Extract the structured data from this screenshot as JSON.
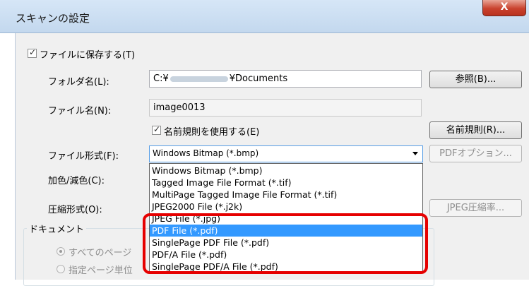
{
  "window": {
    "title": "スキャンの設定",
    "close_label": "X"
  },
  "save_to_file": {
    "label": "ファイルに保存する(T)",
    "checked": true
  },
  "folder": {
    "label": "フォルダ名(L):",
    "value_prefix": "C:¥",
    "value_suffix": "¥Documents",
    "browse_button": "参照(B)..."
  },
  "filename": {
    "label": "ファイル名(N):",
    "value": "image0013"
  },
  "naming_rule": {
    "checkbox_label": "名前規則を使用する(E)",
    "checked": true,
    "button": "名前規則(R)..."
  },
  "file_format": {
    "label": "ファイル形式(F):",
    "selected": "Windows Bitmap (*.bmp)",
    "pdf_options_button": "PDFオプション...",
    "options": [
      "Windows Bitmap (*.bmp)",
      "Tagged Image File Format (*.tif)",
      "MultiPage Tagged Image File Format (*.tif)",
      "JPEG2000 File (*.j2k)",
      "JPEG File (*.jpg)",
      "PDF File (*.pdf)",
      "SinglePage PDF File (*.pdf)",
      "PDF/A File (*.pdf)",
      "SinglePage PDF/A File (*.pdf)"
    ],
    "highlighted": "PDF File (*.pdf)"
  },
  "color_reduction": {
    "label": "加色/減色(C):"
  },
  "compression": {
    "label": "圧縮形式(O):",
    "jpeg_button": "JPEG圧縮率..."
  },
  "document_group": {
    "title": "ドキュメント",
    "all_pages": "すべてのページ",
    "per_page": "指定ページ単位"
  },
  "colors": {
    "accent_highlight": "#e60000",
    "selection": "#3399ff"
  }
}
